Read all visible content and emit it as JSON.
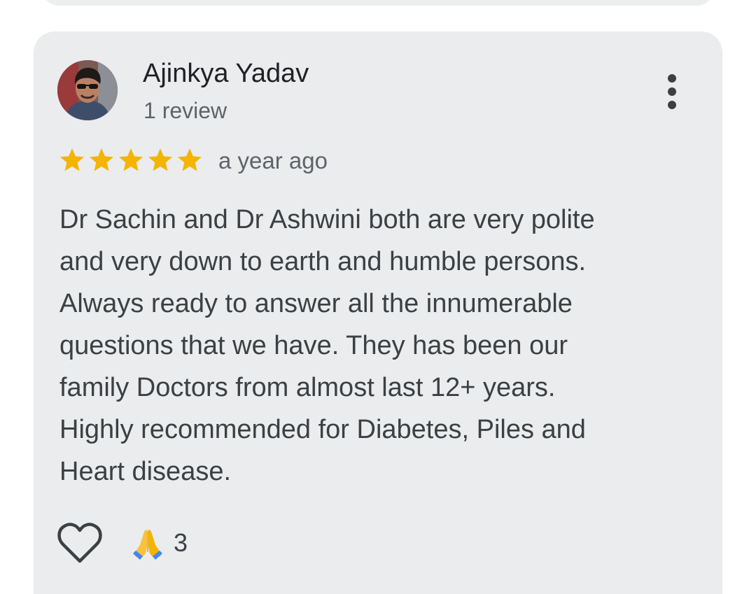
{
  "colors": {
    "card_background": "#eaecee",
    "star": "#f4b400",
    "primary_text": "#202124",
    "secondary_text": "#5f6368",
    "body_text": "#3c4043"
  },
  "review": {
    "author": {
      "name": "Ajinkya Yadav",
      "review_count": "1 review",
      "avatar_icon": "user-photo"
    },
    "menu_icon": "more-vert-icon",
    "rating": 5,
    "rating_max": 5,
    "date": "a year ago",
    "text_lines": [
      "Dr Sachin and Dr Ashwini both are very polite",
      "and very down to earth and humble persons.",
      "Always ready to answer all the innumerable",
      "questions that we have. They has been our",
      "family Doctors from almost last 12+ years.",
      "Highly recommended for Diabetes, Piles and",
      "Heart disease."
    ],
    "like_icon": "heart-outline-icon",
    "reaction": {
      "icon": "folded-hands-emoji",
      "count": "3"
    }
  }
}
